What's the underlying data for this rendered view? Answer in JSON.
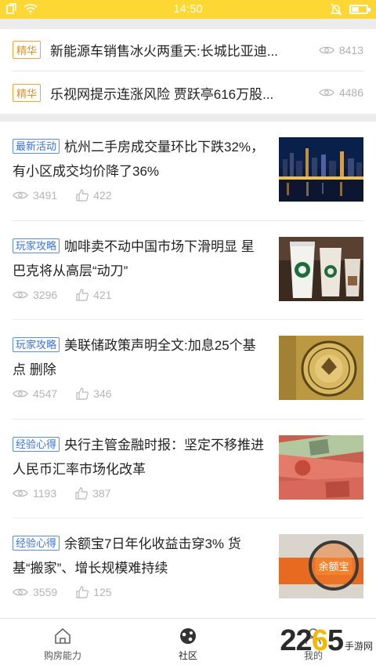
{
  "status_bar": {
    "time": "14:50"
  },
  "top_news": [
    {
      "tag": "精华",
      "title": "新能源车销售冰火两重天:长城比亚迪...",
      "views": "8413"
    },
    {
      "tag": "精华",
      "title": "乐视网提示连涨风险 贾跃亭616万股...",
      "views": "4486"
    }
  ],
  "articles": [
    {
      "tag": "最新活动",
      "title": "杭州二手房成交量环比下跌32%，有小区成交均价降了36%",
      "views": "3491",
      "likes": "422",
      "image": "city-night-skyline"
    },
    {
      "tag": "玩家攻略",
      "title": "咖啡卖不动中国市场下滑明显 星巴克将从高层“动刀”",
      "views": "3296",
      "likes": "421",
      "image": "starbucks-cups"
    },
    {
      "tag": "玩家攻略",
      "title": "美联储政策声明全文:加息25个基点 删除",
      "views": "4547",
      "likes": "346",
      "image": "federal-reserve-seal"
    },
    {
      "tag": "经验心得",
      "title": "央行主管金融时报：坚定不移推进人民币汇率市场化改革",
      "views": "1193",
      "likes": "387",
      "image": "banknotes"
    },
    {
      "tag": "经验心得",
      "title": "余额宝7日年化收益击穿3% 货基“搬家”、增长规模难持续",
      "views": "3559",
      "likes": "125",
      "image": "yuebao-magnifier"
    }
  ],
  "bottom_nav": [
    {
      "label": "购房能力",
      "icon": "home-icon"
    },
    {
      "label": "社区",
      "icon": "community-icon"
    },
    {
      "label": "我的",
      "icon": "user-icon"
    }
  ],
  "watermark": {
    "num_a": "22",
    "num_b": "6",
    "num_c": "5",
    "text": "手游网"
  },
  "colors": {
    "status_bar": "#fdd835",
    "tag_orange": "#e8901a",
    "tag_blue": "#3a73d6"
  }
}
